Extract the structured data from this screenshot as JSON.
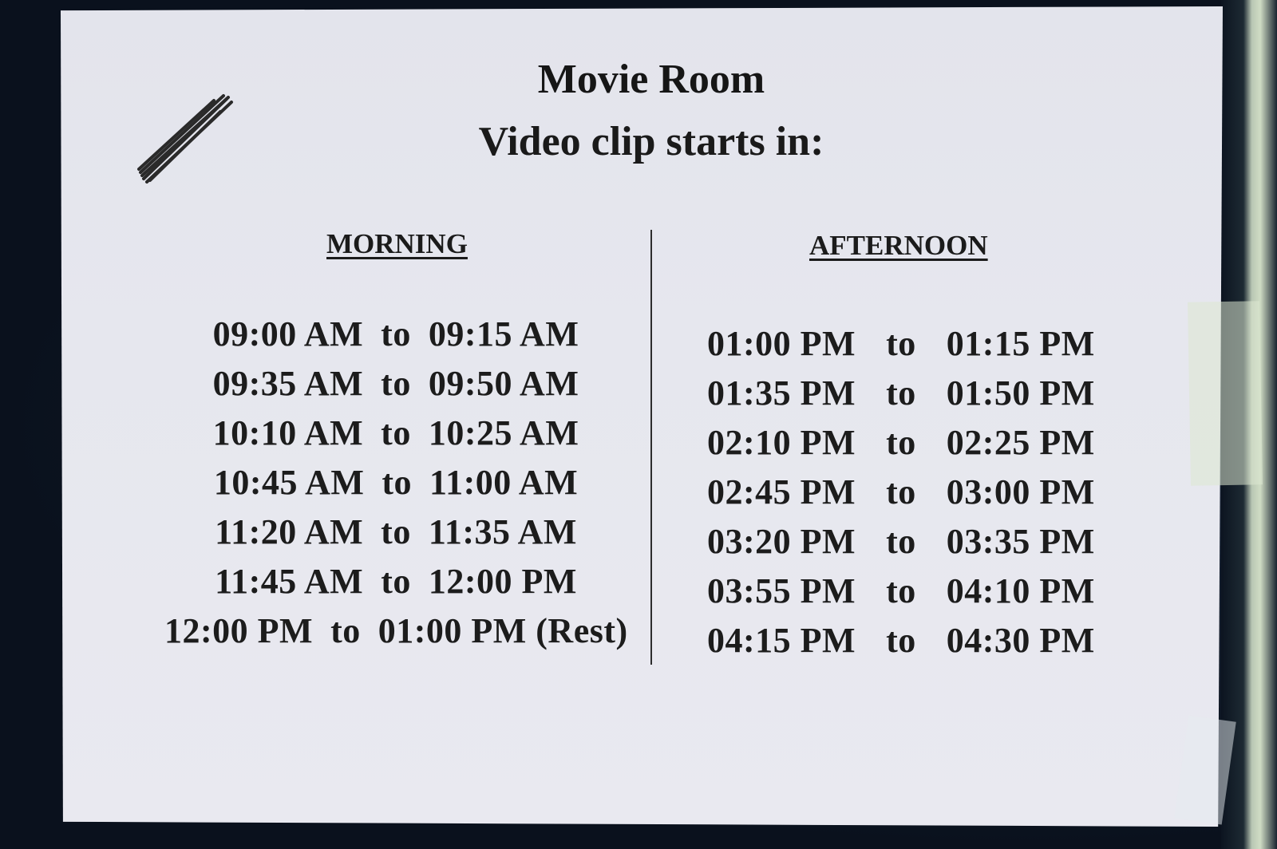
{
  "notice": {
    "title": "Movie Room",
    "subtitle": "Video clip starts in:",
    "morning": {
      "heading": "MORNING",
      "slots": [
        {
          "from": "09:00 AM",
          "sep": "to",
          "to": "09:15 AM"
        },
        {
          "from": "09:35 AM",
          "sep": "to",
          "to": "09:50 AM"
        },
        {
          "from": "10:10 AM",
          "sep": "to",
          "to": "10:25 AM"
        },
        {
          "from": "10:45 AM",
          "sep": "to",
          "to": "11:00 AM"
        },
        {
          "from": "11:20 AM",
          "sep": "to",
          "to": "11:35 AM"
        },
        {
          "from": "11:45 AM",
          "sep": "to",
          "to": "12:00 PM"
        },
        {
          "from": "12:00 PM",
          "sep": "to",
          "to": "01:00 PM (Rest)"
        }
      ]
    },
    "afternoon": {
      "heading": "AFTERNOON",
      "slots": [
        {
          "from": "01:00 PM",
          "sep": "to",
          "to": "01:15 PM"
        },
        {
          "from": "01:35 PM",
          "sep": "to",
          "to": "01:50 PM"
        },
        {
          "from": "02:10 PM",
          "sep": "to",
          "to": "02:25 PM"
        },
        {
          "from": "02:45 PM",
          "sep": "to",
          "to": "03:00 PM"
        },
        {
          "from": "03:20 PM",
          "sep": "to",
          "to": "03:35 PM"
        },
        {
          "from": "03:55 PM",
          "sep": "to",
          "to": "04:10 PM"
        },
        {
          "from": "04:15 PM",
          "sep": "to",
          "to": "04:30 PM"
        }
      ]
    }
  },
  "colors": {
    "paper": "#e6e7ee",
    "ink": "#1c1c1c",
    "board": "#0b1220"
  }
}
